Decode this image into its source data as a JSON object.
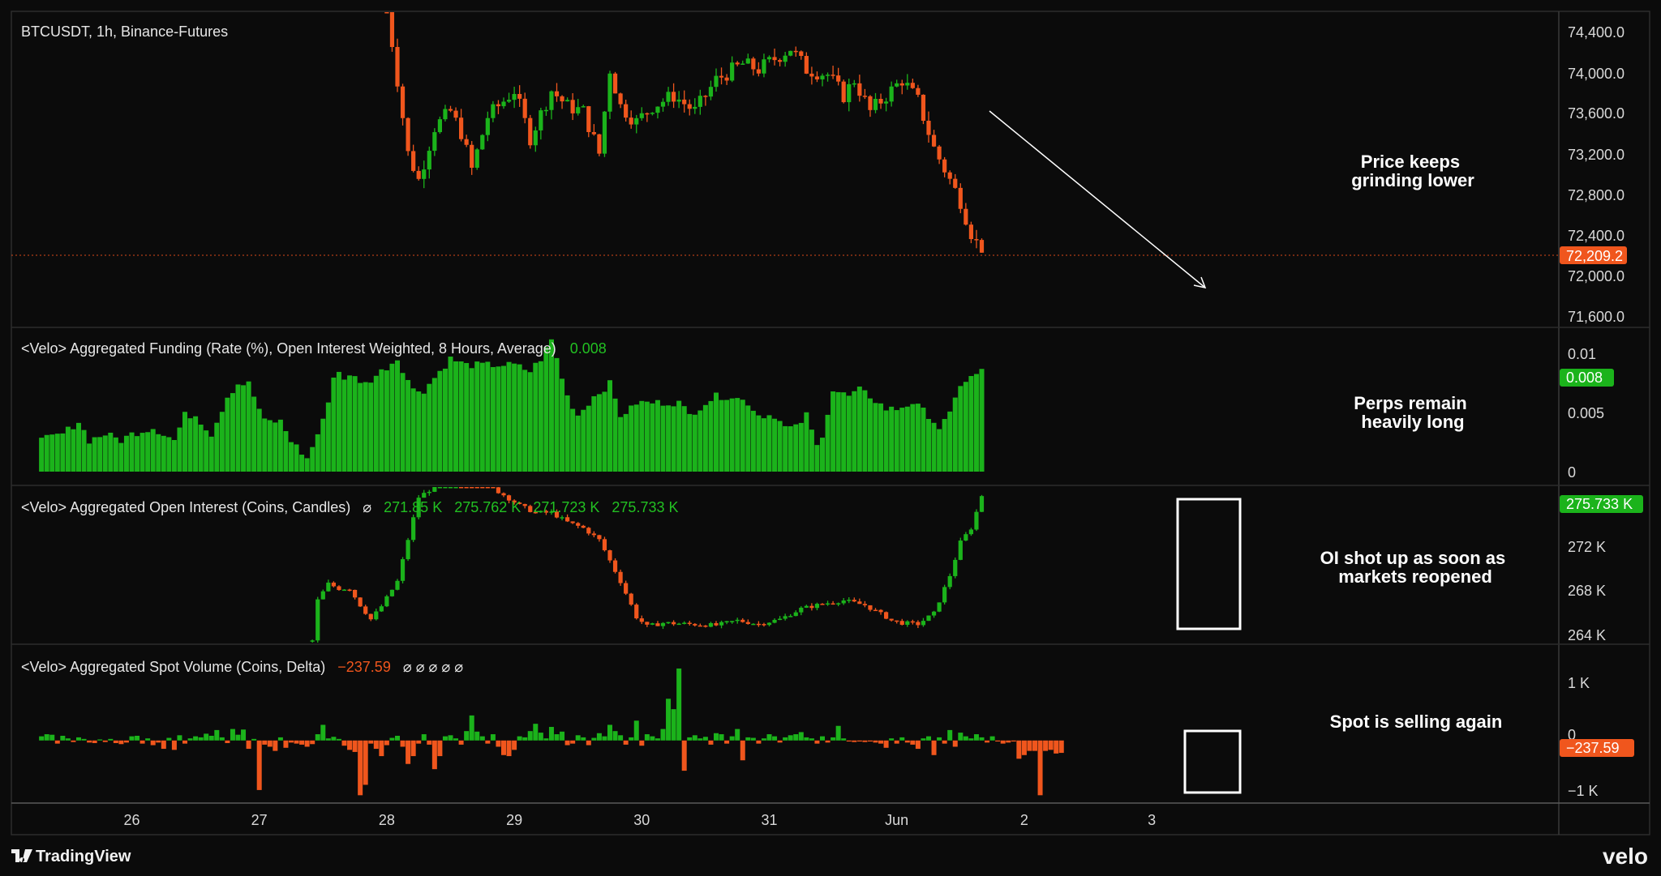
{
  "colors": {
    "background": "#0b0b0b",
    "grid": "#2a2a2a",
    "up": "#1bb31b",
    "down": "#f0561d",
    "text": "#e6e6e6",
    "annotation": "#ffffff"
  },
  "x_axis": {
    "labels": [
      {
        "text": "26",
        "t": 0
      },
      {
        "text": "27",
        "t": 24
      },
      {
        "text": "28",
        "t": 48
      },
      {
        "text": "29",
        "t": 72
      },
      {
        "text": "30",
        "t": 96
      },
      {
        "text": "31",
        "t": 120
      },
      {
        "text": "Jun",
        "t": 144
      },
      {
        "text": "2",
        "t": 168
      },
      {
        "text": "3",
        "t": 192
      }
    ],
    "range_t": [
      -17,
      205
    ]
  },
  "panes": [
    {
      "id": "price",
      "legend": "BTCUSDT, 1h, Binance-Futures",
      "annotation": [
        "Price keeps",
        "grinding lower"
      ],
      "y_ticks": [
        "74,400.0",
        "74,000.0",
        "73,600.0",
        "73,200.0",
        "72,800.0",
        "72,400.0",
        "72,000.0",
        "71,600.0"
      ],
      "badge": "72,209.2"
    },
    {
      "id": "funding",
      "legend": "<Velo> Aggregated Funding (Rate (%), Open Interest Weighted, 8 Hours, Average)",
      "legend_value": "0.008",
      "annotation": [
        "Perps remain",
        "heavily long"
      ],
      "y_ticks": [
        "0.01",
        "0.005",
        "0"
      ],
      "badge": "0.008"
    },
    {
      "id": "oi",
      "legend": "<Velo> Aggregated Open Interest (Coins, Candles)",
      "legend_values": [
        "271.85 K",
        "275.762 K",
        "271.723 K",
        "275.733 K"
      ],
      "annotation": [
        "OI shot up as soon as",
        "markets reopened"
      ],
      "y_ticks": [
        "272 K",
        "268 K",
        "264 K"
      ],
      "badge": "275.733 K"
    },
    {
      "id": "spot",
      "legend": "<Velo> Aggregated Spot Volume (Coins, Delta)",
      "legend_value": "−237.59",
      "annotation": [
        "Spot is selling again"
      ],
      "y_ticks": [
        "1 K",
        "0",
        "−1 K"
      ],
      "badge": "−237.59"
    }
  ],
  "branding": {
    "left": "TradingView",
    "right": "velo"
  },
  "chart_data": [
    {
      "type": "candlestick",
      "title": "BTCUSDT, 1h, Binance-Futures",
      "x_unit": "hours since May 26 00:00",
      "ylim": [
        71500,
        74500
      ],
      "last_value": 72209.2,
      "anchors_t": [
        48,
        52,
        54,
        57,
        60,
        62,
        64,
        67,
        70,
        72,
        75,
        79,
        82,
        85,
        88,
        90,
        92,
        95,
        98,
        102,
        106,
        110,
        115,
        118,
        121,
        124,
        127,
        131,
        134,
        136,
        139,
        142,
        145,
        148,
        151,
        154,
        156,
        158,
        160
      ],
      "anchors_close": [
        74550,
        73150,
        72900,
        73400,
        73550,
        73350,
        73000,
        73500,
        73650,
        73750,
        73300,
        73750,
        73600,
        73550,
        73150,
        73950,
        73600,
        73450,
        73600,
        73700,
        73550,
        73850,
        74000,
        73950,
        74050,
        74150,
        73950,
        73900,
        73700,
        73850,
        73550,
        73700,
        73850,
        73650,
        73200,
        72900,
        72700,
        72400,
        72209
      ]
    },
    {
      "type": "bar",
      "title": "<Velo> Aggregated Funding (Rate (%), Open Interest Weighted, 8 Hours, Average)",
      "ylim": [
        0,
        0.0115
      ],
      "last_value": 0.008,
      "anchors_t": [
        -17,
        -13,
        -10,
        -8,
        -5,
        -2,
        0,
        4,
        8,
        10,
        12,
        15,
        18,
        20,
        22,
        25,
        28,
        30,
        32,
        33,
        36,
        38,
        39,
        40,
        42,
        44,
        47,
        50,
        53,
        55,
        60,
        63,
        65,
        67,
        70,
        72,
        75,
        77,
        79,
        80,
        82,
        84,
        85,
        87,
        90,
        92,
        94,
        95,
        97,
        100,
        103,
        105,
        108,
        110,
        113,
        116,
        118,
        121,
        123,
        125,
        127,
        129,
        130,
        132,
        135,
        137,
        139,
        142,
        144,
        147,
        150,
        152,
        154,
        156,
        158,
        160
      ],
      "anchors_value": [
        0.0025,
        0.003,
        0.004,
        0.0025,
        0.003,
        0.0025,
        0.003,
        0.0035,
        0.0025,
        0.0045,
        0.0045,
        0.003,
        0.006,
        0.007,
        0.007,
        0.004,
        0.004,
        0.0025,
        0.0015,
        0.001,
        0.004,
        0.0075,
        0.008,
        0.0075,
        0.0075,
        0.007,
        0.008,
        0.009,
        0.0065,
        0.0065,
        0.009,
        0.0085,
        0.0085,
        0.0085,
        0.0085,
        0.0085,
        0.008,
        0.009,
        0.0105,
        0.009,
        0.006,
        0.0045,
        0.005,
        0.006,
        0.007,
        0.0045,
        0.005,
        0.0055,
        0.0055,
        0.0055,
        0.0055,
        0.0045,
        0.0055,
        0.006,
        0.006,
        0.0055,
        0.0045,
        0.0045,
        0.0035,
        0.0035,
        0.0045,
        0.002,
        0.003,
        0.0065,
        0.006,
        0.0065,
        0.006,
        0.005,
        0.005,
        0.0055,
        0.0045,
        0.0035,
        0.0045,
        0.007,
        0.0075,
        0.008
      ]
    },
    {
      "type": "candlestick",
      "title": "<Velo> Aggregated Open Interest (Coins, Candles)",
      "x_unit": "hours since May 26 00:00",
      "ylim": [
        263200,
        276600
      ],
      "last_value": 275733,
      "anchors_t": [
        34,
        35,
        37,
        39,
        41,
        43,
        45,
        47,
        50,
        54,
        58,
        62,
        66,
        70,
        73,
        76,
        79,
        82,
        85,
        88,
        92,
        95,
        97,
        100,
        105,
        110,
        114,
        118,
        122,
        126,
        130,
        134,
        138,
        142,
        143,
        145,
        148,
        151,
        154,
        156,
        158,
        160
      ],
      "anchors_value": [
        263500,
        266900,
        268300,
        267900,
        267900,
        266500,
        265300,
        266400,
        268500,
        275600,
        276800,
        277200,
        276900,
        275800,
        274900,
        274300,
        274300,
        273500,
        273000,
        272000,
        268500,
        265500,
        264700,
        265000,
        264900,
        264800,
        265200,
        264900,
        265300,
        266200,
        266600,
        266900,
        266500,
        265500,
        265200,
        265000,
        264900,
        265800,
        269000,
        271800,
        273000,
        275700
      ]
    },
    {
      "type": "bar",
      "title": "<Velo> Aggregated Spot Volume (Coins, Delta)",
      "ylim": [
        -1200,
        1550
      ],
      "last_value": -237.59,
      "values_by_t": {
        "-17": 80,
        "-16": 120,
        "-15": 110,
        "-14": -60,
        "-13": 90,
        "-12": 40,
        "-11": -30,
        "-10": 60,
        "-9": 30,
        "-8": -40,
        "-7": -50,
        "-6": 20,
        "-5": -30,
        "-4": 30,
        "-3": -50,
        "-2": -70,
        "-1": -40,
        "0": 80,
        "1": 90,
        "2": -60,
        "3": 40,
        "4": -90,
        "5": -40,
        "6": -160,
        "7": 50,
        "8": -180,
        "9": 100,
        "10": -60,
        "11": 40,
        "12": 80,
        "13": 60,
        "14": 130,
        "15": 90,
        "16": 200,
        "17": 60,
        "18": -50,
        "19": 220,
        "20": 110,
        "21": 210,
        "22": -160,
        "23": 30,
        "24": -950,
        "25": -80,
        "26": -120,
        "27": -200,
        "28": 60,
        "29": -140,
        "30": -40,
        "31": -60,
        "32": -80,
        "33": -120,
        "34": -70,
        "35": 120,
        "36": 300,
        "37": 40,
        "38": 70,
        "39": 30,
        "40": -100,
        "41": -180,
        "42": -220,
        "43": -1050,
        "44": -850,
        "45": -60,
        "46": -160,
        "47": -300,
        "48": -90,
        "49": 50,
        "50": 90,
        "51": -120,
        "52": -450,
        "53": -300,
        "54": -60,
        "55": 120,
        "56": -80,
        "57": -550,
        "58": -300,
        "59": 80,
        "60": 100,
        "61": 40,
        "62": -80,
        "63": 180,
        "64": 480,
        "65": 170,
        "66": 80,
        "67": -60,
        "68": 120,
        "69": -120,
        "70": -280,
        "71": -300,
        "72": -180,
        "73": 80,
        "74": 60,
        "75": 180,
        "76": 320,
        "77": 150,
        "78": 40,
        "79": 260,
        "80": 120,
        "81": 170,
        "82": -90,
        "83": -60,
        "84": 100,
        "85": 60,
        "86": -90,
        "87": 50,
        "88": 140,
        "89": 80,
        "90": 300,
        "91": 180,
        "92": 100,
        "93": -80,
        "94": 60,
        "95": 380,
        "96": -100,
        "97": 120,
        "98": 80,
        "99": 40,
        "100": 220,
        "101": 800,
        "102": 600,
        "103": 1380,
        "104": -580,
        "105": 60,
        "106": 100,
        "107": 40,
        "108": 70,
        "109": -80,
        "110": 140,
        "111": 120,
        "112": -60,
        "113": 80,
        "114": 220,
        "115": -380,
        "116": 60,
        "117": 50,
        "118": -60,
        "119": 40,
        "120": 120,
        "121": 80,
        "122": -40,
        "123": 60,
        "124": 100,
        "125": 120,
        "126": 160,
        "127": 60,
        "128": 40,
        "129": -60,
        "130": 80,
        "131": -40,
        "132": 60,
        "133": 280,
        "134": 40,
        "135": -20,
        "136": -30,
        "137": -20,
        "138": -30,
        "139": -20,
        "140": -40,
        "141": -60,
        "142": -140,
        "143": 40,
        "144": -60,
        "145": 60,
        "146": -40,
        "147": -80,
        "148": -160,
        "149": 40,
        "150": 80,
        "151": -280,
        "152": 60,
        "153": -60,
        "154": 200,
        "155": -120,
        "156": 150,
        "157": 80,
        "158": 40,
        "159": 120,
        "160": 60,
        "161": -40,
        "162": 80,
        "163": -20,
        "164": -60,
        "165": -40,
        "166": -20,
        "167": -350,
        "168": -280,
        "169": -200,
        "170": -200,
        "171": -1050,
        "172": -200,
        "173": -180,
        "174": -250,
        "175": -237.59
      }
    }
  ]
}
